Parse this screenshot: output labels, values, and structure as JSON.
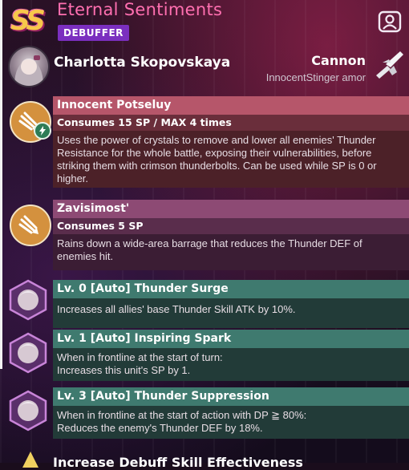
{
  "header": {
    "rarity": "SS",
    "title": "Eternal Sentiments",
    "tag": "DEBUFFER"
  },
  "character": {
    "name": "Charlotta Skopovskaya",
    "weapon_type": "Cannon",
    "weapon_name": "InnocentStinger amor"
  },
  "skills": [
    {
      "name": "Innocent Potseluy",
      "cost": "Consumes 15 SP / MAX 4 times",
      "description": "Uses the power of crystals to remove and lower all enemies' Thunder Resistance for the whole battle, exposing their vulnerabilities, before striking them with crimson thunderbolts. Can be used while SP is 0 or higher.",
      "element": "thunder"
    },
    {
      "name": "Zavisimost'",
      "cost": "Consumes 5 SP",
      "description": "Rains down a wide-area barrage that reduces the Thunder DEF of enemies hit."
    }
  ],
  "passives": [
    {
      "name": "Lv. 0 [Auto] Thunder Surge",
      "description": "Increases all allies' base Thunder Skill ATK by 10%."
    },
    {
      "name": "Lv. 1 [Auto] Inspiring Spark",
      "description": "When in frontline at the start of turn:\nIncreases this unit's SP by 1."
    },
    {
      "name": "Lv. 3 [Auto] Thunder Suppression",
      "description": "When in frontline at the start of action with DP ≧ 80%:\nReduces the enemy's Thunder DEF by 18%."
    }
  ],
  "next_row": {
    "name": "Increase Debuff Skill Effectiveness"
  },
  "colors": {
    "title": "#ff6fb0",
    "tag": "#7b2fbf",
    "skill_header": "#b6566a",
    "passive_header": "#3f7a6f"
  }
}
